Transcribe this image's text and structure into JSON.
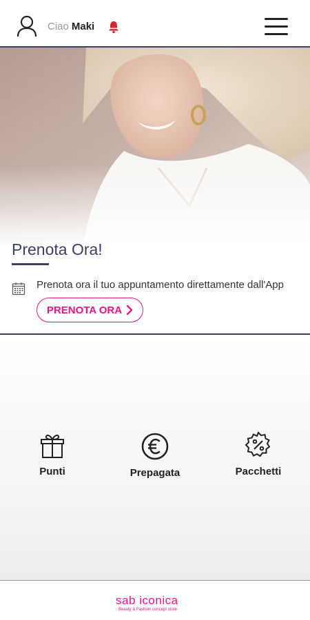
{
  "header": {
    "greeting": "Ciao",
    "user_name": "Maki",
    "user_icon": "user-icon",
    "bell_icon": "bell-icon",
    "menu_icon": "hamburger-menu-icon"
  },
  "hero": {
    "title": "Prenota Ora!",
    "description": "Prenota ora il tuo appuntamento direttamente dall'App",
    "calendar_icon": "calendar-icon",
    "button_label": "PRENOTA ORA"
  },
  "quick_actions": [
    {
      "label": "Punti",
      "icon": "gift-icon"
    },
    {
      "label": "Prepagata",
      "icon": "euro-icon"
    },
    {
      "label": "Pacchetti",
      "icon": "percent-badge-icon"
    }
  ],
  "footer": {
    "logo_text": "sab iconica",
    "logo_tagline": "Beauty & Fashion concept store"
  },
  "colors": {
    "accent": "#e0168a",
    "navy": "#3b3f63",
    "bell": "#d9262c"
  }
}
